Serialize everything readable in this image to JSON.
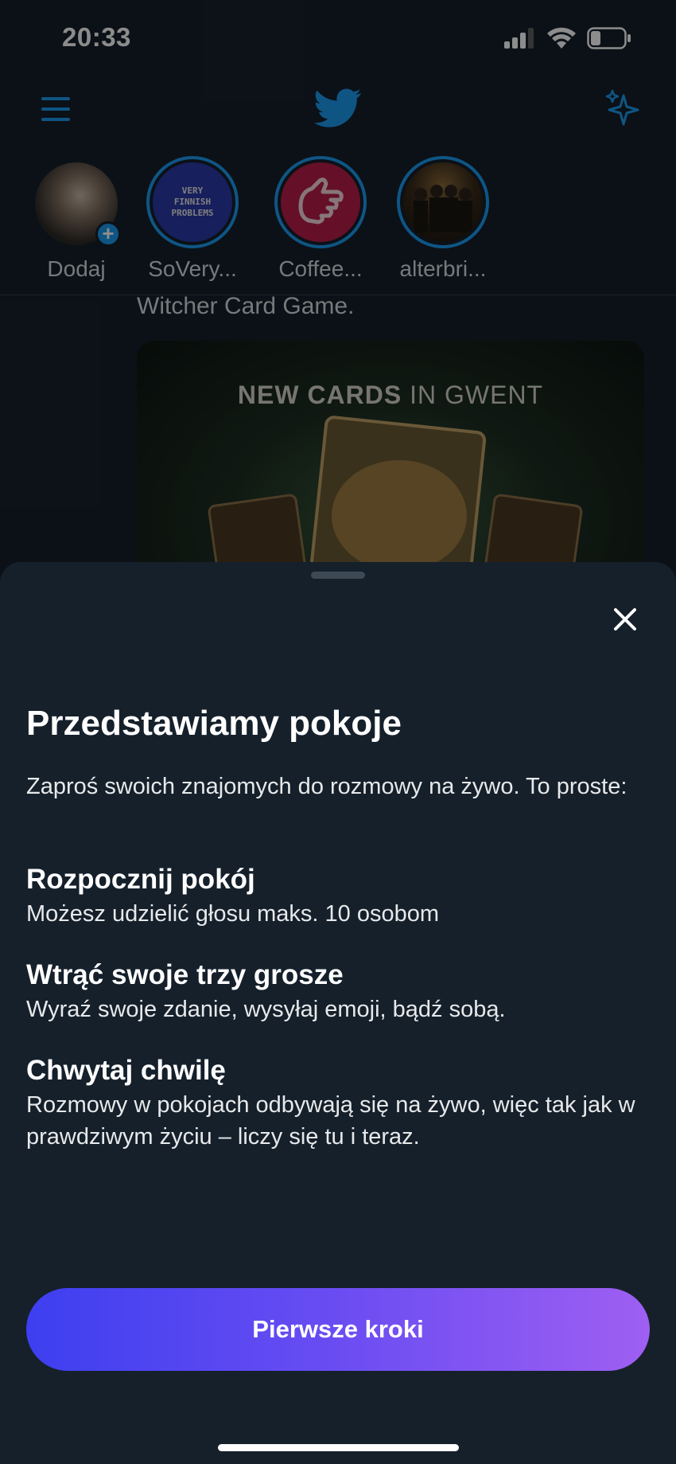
{
  "status_bar": {
    "time": "20:33"
  },
  "fleets": [
    {
      "label": "Dodaj"
    },
    {
      "label": "SoVery...",
      "avatar_text": "VERY\nFINNISH\nPROBLEMS"
    },
    {
      "label": "Coffee..."
    },
    {
      "label": "alterbri..."
    }
  ],
  "tweet": {
    "text": "Witcher Card Game.",
    "media_title_bold": "NEW CARDS",
    "media_title_rest": " IN GWENT"
  },
  "sheet": {
    "title": "Przedstawiamy pokoje",
    "intro": "Zaproś swoich znajomych do rozmowy na żywo. To proste:",
    "features": [
      {
        "title": "Rozpocznij pokój",
        "desc": "Możesz udzielić głosu maks. 10 osobom"
      },
      {
        "title": "Wtrąć swoje trzy grosze",
        "desc": "Wyraź swoje zdanie, wysyłaj emoji, bądź sobą."
      },
      {
        "title": "Chwytaj chwilę",
        "desc": "Rozmowy w pokojach odbywają się na żywo, więc tak jak w prawdziwym życiu – liczy się tu i teraz."
      }
    ],
    "cta_label": "Pierwsze kroki"
  },
  "colors": {
    "accent": "#1d9bf0",
    "background": "#15202b",
    "cta_gradient_start": "#3d3ff0",
    "cta_gradient_end": "#9f5ff2"
  }
}
